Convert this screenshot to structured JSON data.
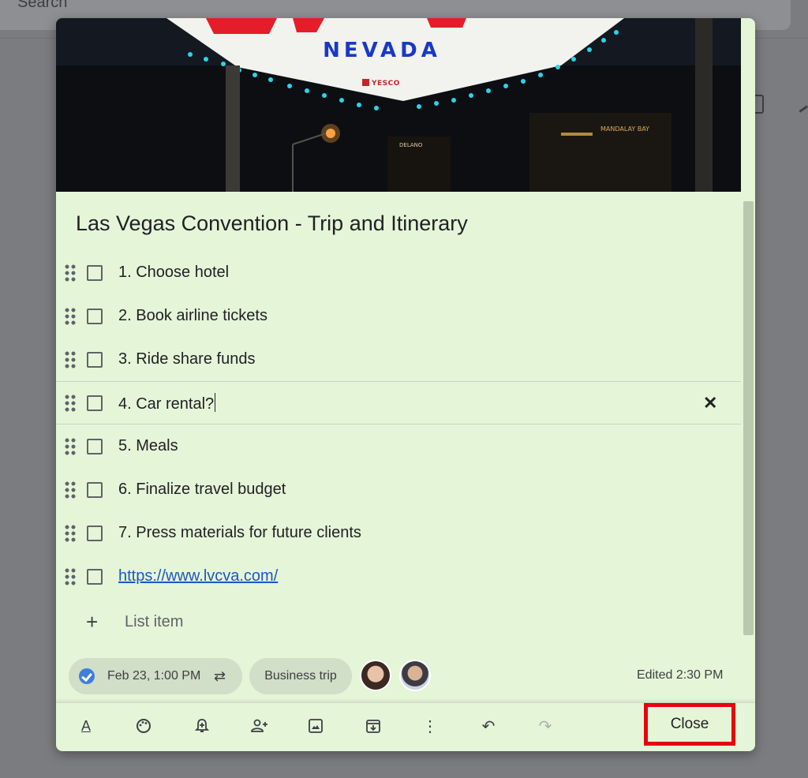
{
  "background": {
    "search_placeholder": "Search"
  },
  "note": {
    "title": "Las Vegas Convention - Trip and Itinerary",
    "image": {
      "sign_word": "NEVADA",
      "sign_brand": "YESCO",
      "hotel_sign": "MANDALAY BAY",
      "hotel_sign2": "DELANO"
    },
    "items": [
      {
        "text": "1. Choose hotel",
        "checked": false
      },
      {
        "text": "2. Book airline tickets",
        "checked": false
      },
      {
        "text": "3. Ride share funds",
        "checked": false
      },
      {
        "text": "4. Car rental?",
        "checked": false,
        "active": true
      },
      {
        "text": "5. Meals",
        "checked": false
      },
      {
        "text": "6. Finalize travel budget",
        "checked": false
      },
      {
        "text": "7. Press materials for future clients",
        "checked": false
      },
      {
        "text": "https://www.lvcva.com/",
        "checked": false,
        "link": true
      }
    ],
    "add_item_placeholder": "List item",
    "reminder": {
      "text": "Feb 23, 1:00 PM",
      "repeat": true
    },
    "label": "Business trip",
    "edited": "Edited 2:30 PM"
  },
  "toolbar": {
    "icons": [
      "format-text-icon",
      "palette-icon",
      "reminder-bell-icon",
      "collaborator-icon",
      "image-icon",
      "archive-icon",
      "more-vert-icon",
      "undo-icon",
      "redo-icon"
    ],
    "close_label": "Close"
  },
  "colors": {
    "note_bg": "#e5f5d8",
    "chip_bg": "#d1dec8",
    "highlight_border": "#e8000f",
    "link": "#1a58c5"
  }
}
